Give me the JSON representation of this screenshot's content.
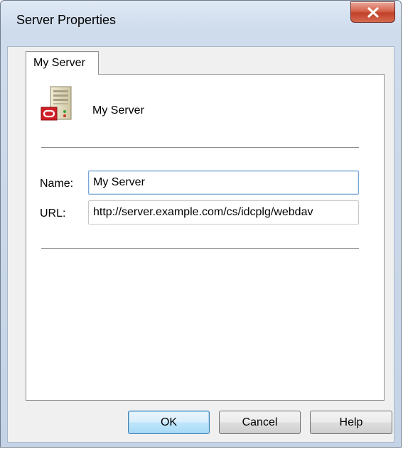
{
  "window": {
    "title": "Server Properties"
  },
  "tabs": [
    {
      "label": "My Server",
      "selected": true
    }
  ],
  "header": {
    "icon": "oracle-server-icon",
    "name": "My Server"
  },
  "fields": {
    "name": {
      "label": "Name:",
      "value": "My Server"
    },
    "url": {
      "label": "URL:",
      "value": "http://server.example.com/cs/idcplg/webdav"
    }
  },
  "buttons": {
    "ok": "OK",
    "cancel": "Cancel",
    "help": "Help"
  },
  "colors": {
    "close_button": "#c2402a",
    "brand_red": "#d01f27",
    "focus_border": "#7aa7d6"
  }
}
